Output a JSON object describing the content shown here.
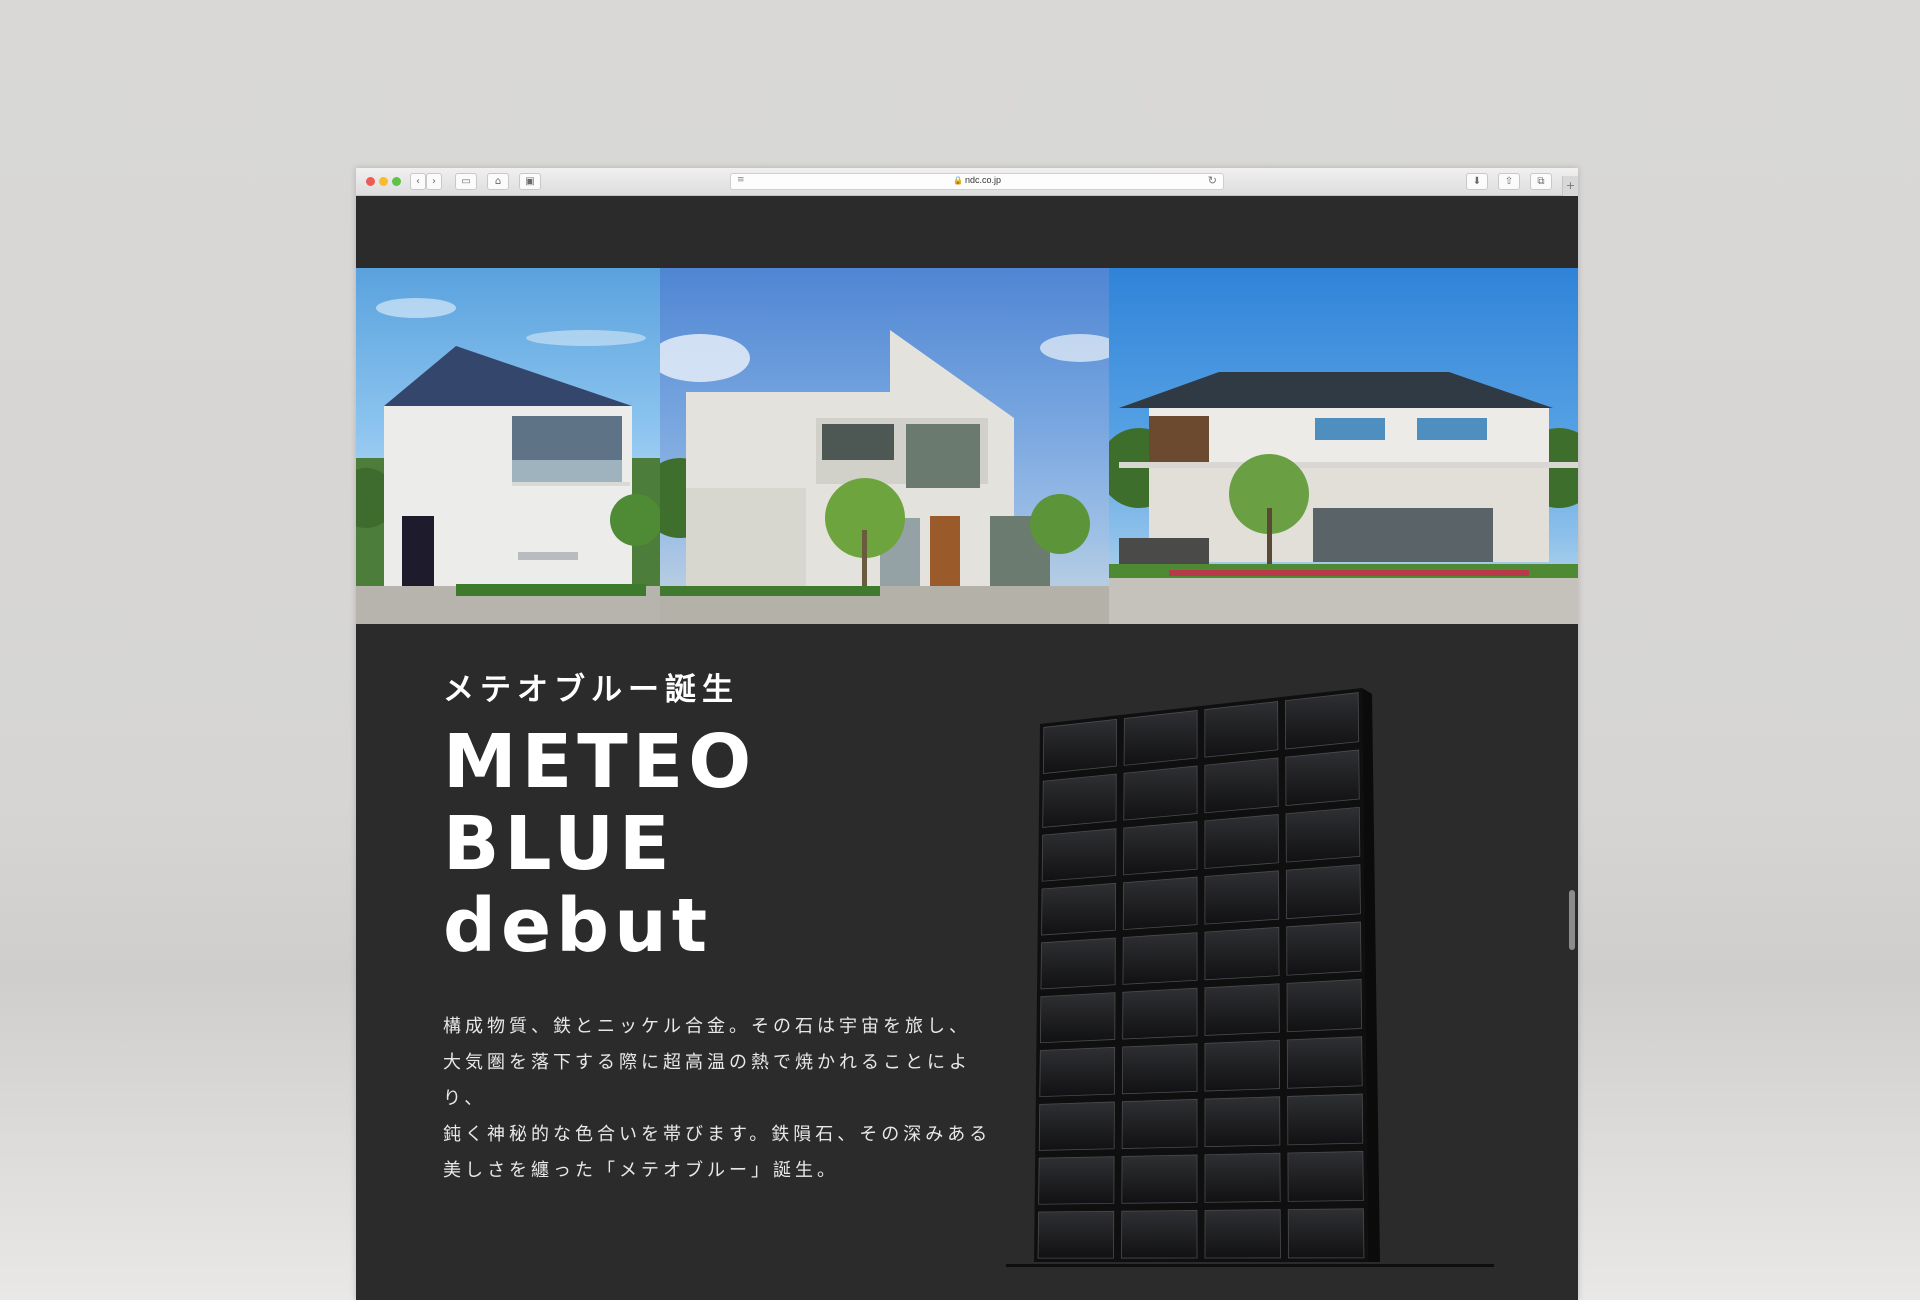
{
  "browser": {
    "url": "ndc.co.jp",
    "buttons": {
      "back": "‹",
      "forward": "›",
      "sidebar": "▭",
      "home": "⌂",
      "screen": "▣",
      "reader": "≡",
      "reload": "↻",
      "downloads": "⬇",
      "share": "⇧",
      "tabs": "⧉",
      "new_tab": "+"
    }
  },
  "colors": {
    "page_bg": "#2b2b2b",
    "text": "#ffffff",
    "body_text": "#e8e8e8"
  },
  "hero": {
    "photos": [
      {
        "name": "house-photo-1",
        "icon": "house-photo"
      },
      {
        "name": "house-photo-2",
        "icon": "house-photo"
      },
      {
        "name": "house-photo-3",
        "icon": "house-photo"
      }
    ]
  },
  "section": {
    "subtitle": "メテオブルー誕生",
    "title_line1": "METEO BLUE",
    "title_line2": "debut",
    "body_lines": [
      "構成物質、鉄とニッケル合金。その石は宇宙を旅し、",
      "大気圏を落下する際に超高温の熱で焼かれることにより、",
      "鈍く神秘的な色合いを帯びます。鉄隕石、その深みある",
      "美しさを纏った「メテオブルー」誕生。"
    ]
  },
  "product": {
    "image": "stone-tile-panel"
  }
}
